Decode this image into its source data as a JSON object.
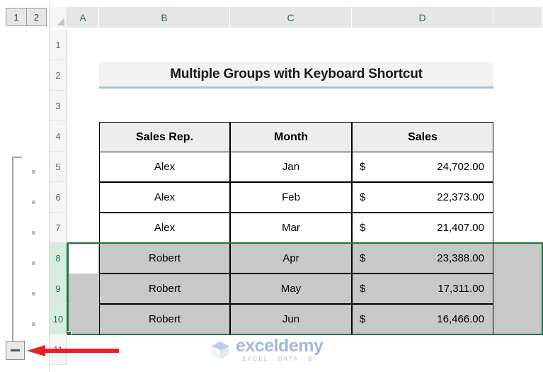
{
  "outline": {
    "level_buttons": [
      {
        "label": "1"
      },
      {
        "label": "2"
      }
    ],
    "collapse_button_label": "−",
    "grouped_rows": [
      "5",
      "6",
      "7",
      "8",
      "9",
      "10"
    ]
  },
  "grid": {
    "columns": [
      "A",
      "B",
      "C",
      "D"
    ],
    "rows": [
      "1",
      "2",
      "3",
      "4",
      "5",
      "6",
      "7",
      "8",
      "9",
      "10",
      "11"
    ],
    "selected_rows": [
      "8",
      "9",
      "10"
    ],
    "active_cell": "A8"
  },
  "title": {
    "text": "Multiple Groups with Keyboard Shortcut",
    "accent_color": "#a8c0e0"
  },
  "table": {
    "headers": [
      "Sales Rep.",
      "Month",
      "Sales"
    ],
    "rows": [
      {
        "rep": "Alex",
        "month": "Jan",
        "currency": "$",
        "amount": "24,702.00",
        "selected": false
      },
      {
        "rep": "Alex",
        "month": "Feb",
        "currency": "$",
        "amount": "22,373.00",
        "selected": false
      },
      {
        "rep": "Alex",
        "month": "Mar",
        "currency": "$",
        "amount": "21,407.00",
        "selected": false
      },
      {
        "rep": "Robert",
        "month": "Apr",
        "currency": "$",
        "amount": "23,388.00",
        "selected": true
      },
      {
        "rep": "Robert",
        "month": "May",
        "currency": "$",
        "amount": "17,311.00",
        "selected": true
      },
      {
        "rep": "Robert",
        "month": "Jun",
        "currency": "$",
        "amount": "16,466.00",
        "selected": true
      }
    ]
  },
  "watermark": {
    "name": "exceldemy",
    "tagline": "EXCEL · DATA · BI",
    "color": "#9db6d8"
  },
  "colors": {
    "selection_green": "#217346",
    "selection_gray": "#c8c8c8",
    "header_gray": "#e6e6e6",
    "row_header_selected": "#d6ecdd",
    "annotation_red": "#ee1c25"
  }
}
